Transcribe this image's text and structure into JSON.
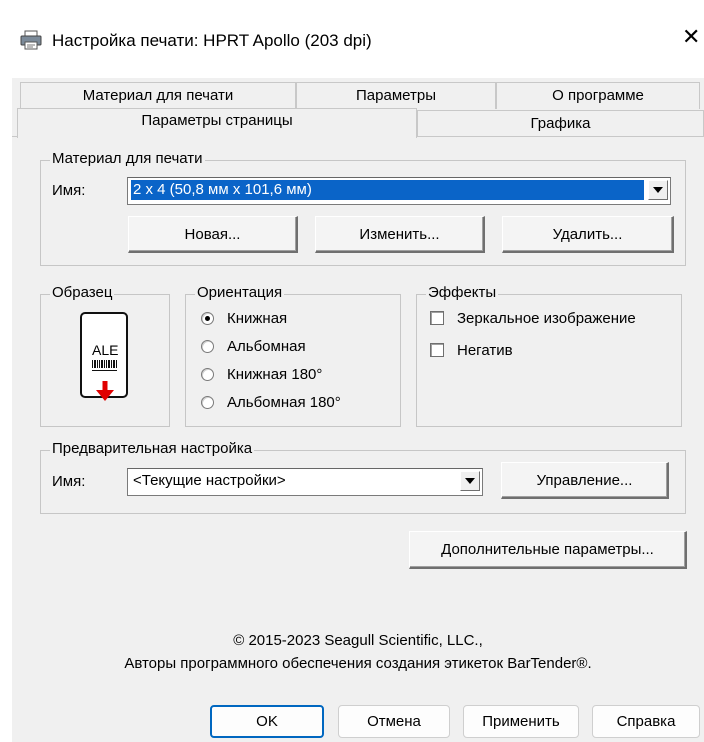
{
  "window": {
    "title": "Настройка печати: HPRT Apollo (203 dpi)",
    "close_glyph": "✕"
  },
  "tabs": {
    "row1": [
      "Материал для печати",
      "Параметры",
      "О программе"
    ],
    "row2": [
      "Параметры страницы",
      "Графика"
    ],
    "active": "Параметры страницы"
  },
  "media": {
    "legend": "Материал для печати",
    "name_label": "Имя:",
    "name_value": "2 x 4 (50,8 мм x 101,6 мм)",
    "btn_new": "Новая...",
    "btn_edit": "Изменить...",
    "btn_delete": "Удалить..."
  },
  "sample": {
    "legend": "Образец",
    "label_text": "ALE",
    "arrow_color": "#e00000"
  },
  "orientation": {
    "legend": "Ориентация",
    "options": [
      "Книжная",
      "Альбомная",
      "Книжная 180°",
      "Альбомная 180°"
    ],
    "selected": "Книжная"
  },
  "effects": {
    "legend": "Эффекты",
    "mirror_label": "Зеркальное изображение",
    "mirror_checked": false,
    "negative_label": "Негатив",
    "negative_checked": false
  },
  "preset": {
    "legend": "Предварительная настройка",
    "name_label": "Имя:",
    "name_value": "<Текущие настройки>",
    "btn_manage": "Управление..."
  },
  "advanced_button": "Дополнительные параметры...",
  "copyright": {
    "line1": "© 2015-2023 Seagull Scientific, LLC.,",
    "line2": "Авторы программного обеспечения создания этикеток BarTender®."
  },
  "footer": {
    "ok": "OK",
    "cancel": "Отмена",
    "apply": "Применить",
    "help": "Справка"
  },
  "colors": {
    "accent": "#0067c0",
    "selection": "#0a64c8",
    "dialog_bg": "#f0f0f0"
  }
}
